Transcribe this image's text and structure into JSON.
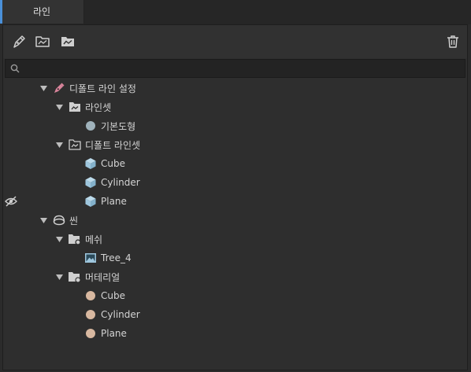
{
  "tab": {
    "label": "라인"
  },
  "search": {
    "value": "",
    "placeholder": ""
  },
  "tree": {
    "default_line_settings": "디폴트 라인 설정",
    "lineset": "라인셋",
    "primitive": "기본도형",
    "default_lineset": "디폴트 라인셋",
    "cube": "Cube",
    "cylinder": "Cylinder",
    "plane": "Plane",
    "scene": "씬",
    "mesh": "메쉬",
    "tree4": "Tree_4",
    "material": "머테리얼",
    "mat_cube": "Cube",
    "mat_cylinder": "Cylinder",
    "mat_plane": "Plane"
  },
  "colors": {
    "accent": "#4a90d9",
    "pen": "#d9849b",
    "sphere": "#9fb2bb",
    "cube": "#9ec6dd",
    "material": "#d8b8a0"
  }
}
